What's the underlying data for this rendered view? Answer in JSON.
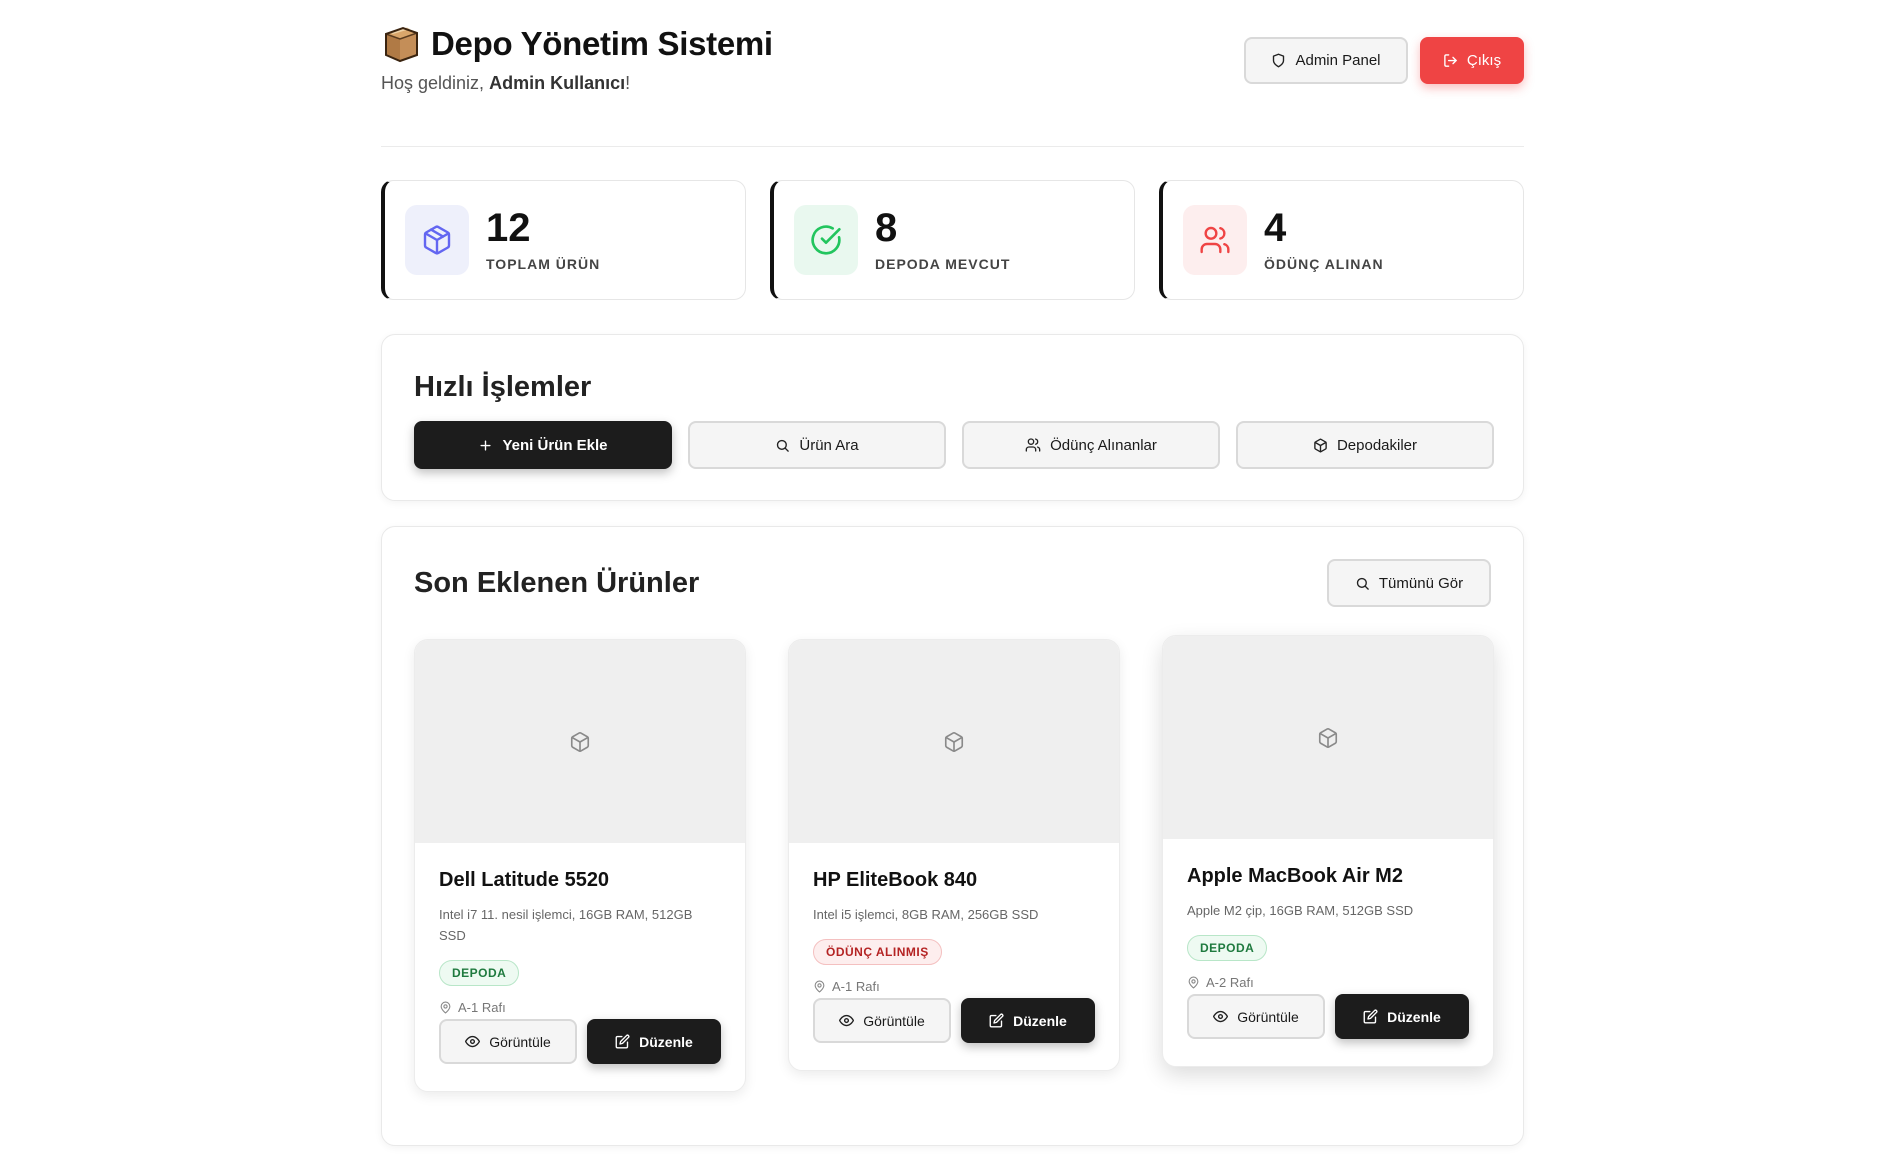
{
  "header": {
    "title": "Depo Yönetim Sistemi",
    "welcome_prefix": "Hoş geldiniz,",
    "user_name": "Admin Kullanıcı",
    "welcome_suffix": "!",
    "admin_button": "Admin Panel",
    "logout_button": "Çıkış"
  },
  "stats": [
    {
      "value": "12",
      "label": "TOPLAM ÜRÜN",
      "icon": "box-icon",
      "color": "#6366f1"
    },
    {
      "value": "8",
      "label": "DEPODA MEVCUT",
      "icon": "check-circle-icon",
      "color": "#22c55e"
    },
    {
      "value": "4",
      "label": "ÖDÜNÇ ALINAN",
      "icon": "users-icon",
      "color": "#ef4444"
    }
  ],
  "quick_actions": {
    "title": "Hızlı İşlemler",
    "buttons": [
      {
        "label": "Yeni Ürün Ekle",
        "icon": "plus-icon"
      },
      {
        "label": "Ürün Ara",
        "icon": "search-icon"
      },
      {
        "label": "Ödünç Alınanlar",
        "icon": "users-icon"
      },
      {
        "label": "Depodakiler",
        "icon": "box-icon"
      }
    ]
  },
  "recent": {
    "title": "Son Eklenen Ürünler",
    "see_all": "Tümünü Gör",
    "products": [
      {
        "name": "Dell Latitude 5520",
        "description": "Intel i7 11. nesil işlemci, 16GB RAM, 512GB SSD",
        "status": "DEPODA",
        "location": "A-1 Rafı",
        "view": "Görüntüle",
        "edit": "Düzenle"
      },
      {
        "name": "HP EliteBook 840",
        "description": "Intel i5 işlemci, 8GB RAM, 256GB SSD",
        "status": "ÖDÜNÇ ALINMIŞ",
        "location": "A-1 Rafı",
        "view": "Görüntüle",
        "edit": "Düzenle"
      },
      {
        "name": "Apple MacBook Air M2",
        "description": "Apple M2 çip, 16GB RAM, 512GB SSD",
        "status": "DEPODA",
        "location": "A-2 Rafı",
        "view": "Görüntüle",
        "edit": "Düzenle"
      }
    ]
  },
  "colors": {
    "accent_dark": "#1c1c1c",
    "danger": "#ef4444",
    "success": "#22c55e",
    "primary": "#6366f1"
  }
}
